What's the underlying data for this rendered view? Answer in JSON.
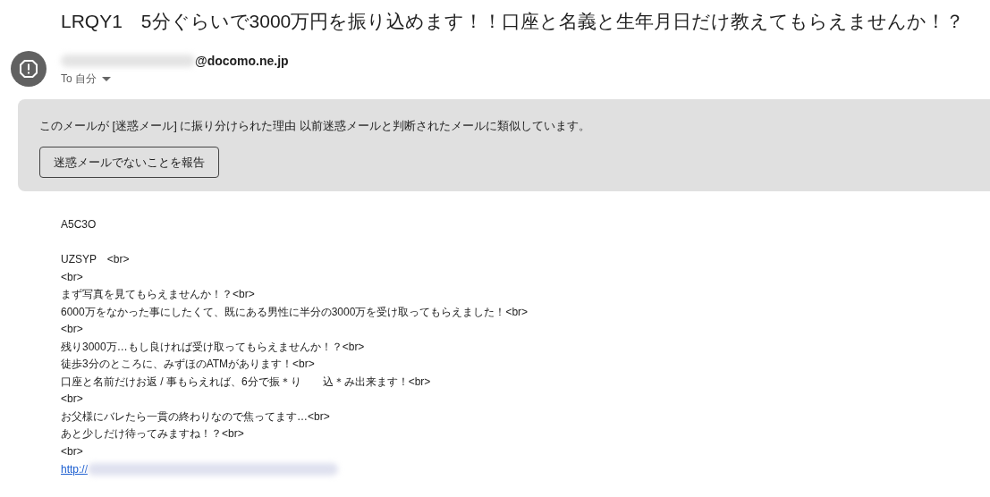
{
  "subject": "LRQY1　5分ぐらいで3000万円を振り込めます！！口座と名義と生年月日だけ教えてもらえませんか！？",
  "sender": {
    "address_visible": "@docomo.ne.jp",
    "name_redacted": true,
    "recipient": "To 自分"
  },
  "spam_notice": {
    "message": "このメールが [迷惑メール] に振り分けられた理由 以前迷惑メールと判断されたメールに類似しています。",
    "button": "迷惑メールでないことを報告"
  },
  "body": [
    [
      "A5C3O"
    ],
    [
      "UZSYP　<br>",
      "<br>",
      "まず写真を見てもらえませんか！？<br>",
      "6000万をなかった事にしたくて、既にある男性に半分の3000万を受け取ってもらえました！<br>",
      "<br>",
      "残り3000万…もし良ければ受け取ってもらえませんか！？<br>",
      "徒歩3分のところに、みずほのATMがあります！<br>",
      "口座と名前だけお返 / 事もらえれば、6分で振＊り　　込＊み出来ます！<br>",
      "<br>",
      "お父様にバレたら一貫の終わりなので焦ってます…<br>",
      "あと少しだけ待ってみますね！？<br>",
      "<br>"
    ]
  ],
  "link": {
    "text": "http://",
    "url_redacted": true
  }
}
